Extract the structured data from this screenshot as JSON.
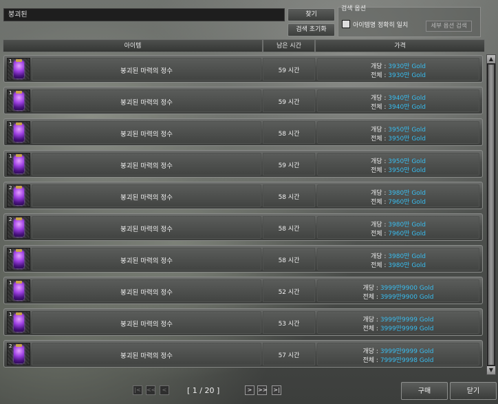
{
  "search": {
    "value": "붕괴된",
    "find_label": "찾기",
    "reset_label": "검색 초기화"
  },
  "options": {
    "title": "검색 옵션",
    "exact_label": "아이템명 정확히 일치",
    "exact_checked": false,
    "detail_label": "세부 옵션 검색"
  },
  "table": {
    "headers": {
      "item": "아이템",
      "time": "남은 시간",
      "price": "가격"
    },
    "unit_label": "개당 : ",
    "total_label": "전체 : ",
    "rows": [
      {
        "qty": "1",
        "name": "붕괴된 마력의 정수",
        "time": "59 시간",
        "unit": "3930만 Gold",
        "total": "3930만 Gold"
      },
      {
        "qty": "1",
        "name": "붕괴된 마력의 정수",
        "time": "59 시간",
        "unit": "3940만 Gold",
        "total": "3940만 Gold"
      },
      {
        "qty": "1",
        "name": "붕괴된 마력의 정수",
        "time": "58 시간",
        "unit": "3950만 Gold",
        "total": "3950만 Gold"
      },
      {
        "qty": "1",
        "name": "붕괴된 마력의 정수",
        "time": "59 시간",
        "unit": "3950만 Gold",
        "total": "3950만 Gold"
      },
      {
        "qty": "2",
        "name": "붕괴된 마력의 정수",
        "time": "58 시간",
        "unit": "3980만 Gold",
        "total": "7960만 Gold"
      },
      {
        "qty": "2",
        "name": "붕괴된 마력의 정수",
        "time": "58 시간",
        "unit": "3980만 Gold",
        "total": "7960만 Gold"
      },
      {
        "qty": "1",
        "name": "붕괴된 마력의 정수",
        "time": "58 시간",
        "unit": "3980만 Gold",
        "total": "3980만 Gold"
      },
      {
        "qty": "1",
        "name": "붕괴된 마력의 정수",
        "time": "52 시간",
        "unit": "3999만9900 Gold",
        "total": "3999만9900 Gold"
      },
      {
        "qty": "1",
        "name": "붕괴된 마력의 정수",
        "time": "53 시간",
        "unit": "3999만9999 Gold",
        "total": "3999만9999 Gold"
      },
      {
        "qty": "2",
        "name": "붕괴된 마력의 정수",
        "time": "57 시간",
        "unit": "3999만9999 Gold",
        "total": "7999만9998 Gold"
      }
    ]
  },
  "pagination": {
    "text": "[ 1 / 20 ]",
    "first": "|<",
    "prev10": "<<",
    "prev": "<",
    "next": ">",
    "next10": ">>",
    "last": ">|"
  },
  "actions": {
    "buy_label": "구매",
    "close_label": "닫기"
  },
  "scrollbar": {
    "up": "▲",
    "down": "▼"
  },
  "icons": {
    "item_icon": "purple-essence-icon"
  },
  "colors": {
    "price_value": "#38bdf0"
  }
}
